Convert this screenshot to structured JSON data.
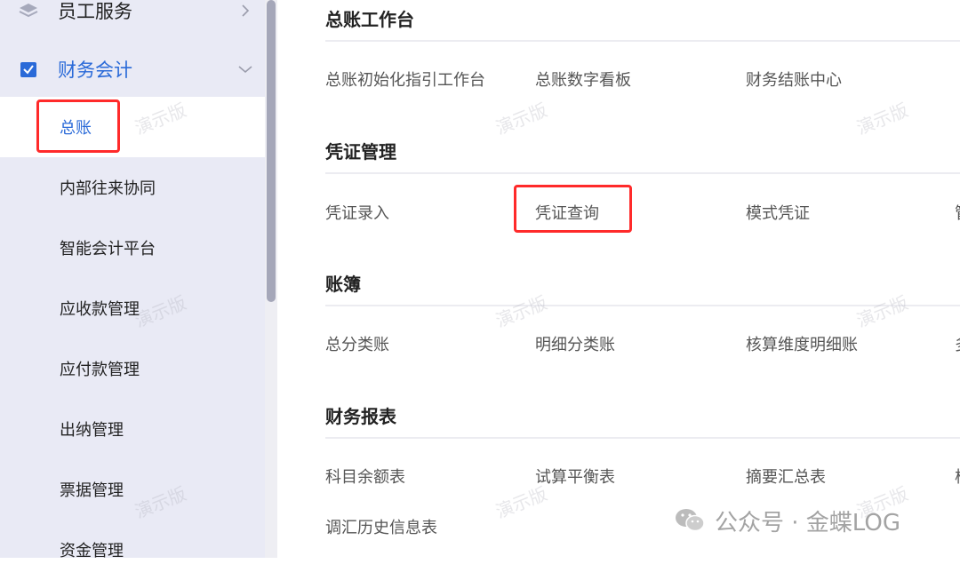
{
  "sidebar": {
    "groups": [
      {
        "label": "员工服务",
        "icon": "layers-icon"
      },
      {
        "label": "财务会计",
        "icon": "checkbox-icon",
        "color": "#2a6ad8"
      }
    ],
    "items": [
      {
        "label": "总账",
        "active": true
      },
      {
        "label": "内部往来协同"
      },
      {
        "label": "智能会计平台"
      },
      {
        "label": "应收款管理"
      },
      {
        "label": "应付款管理"
      },
      {
        "label": "出纳管理"
      },
      {
        "label": "票据管理"
      },
      {
        "label": "资金管理"
      }
    ]
  },
  "main": {
    "sections": [
      {
        "title": "总账工作台",
        "links": [
          "总账初始化指引工作台",
          "总账数字看板",
          "财务结账中心"
        ]
      },
      {
        "title": "凭证管理",
        "links": [
          "凭证录入",
          "凭证查询",
          "模式凭证",
          "管"
        ]
      },
      {
        "title": "账簿",
        "links": [
          "总分类账",
          "明细分类账",
          "核算维度明细账",
          "多"
        ]
      },
      {
        "title": "财务报表",
        "links": [
          "科目余额表",
          "试算平衡表",
          "摘要汇总表",
          "核",
          "调汇历史信息表"
        ]
      }
    ]
  },
  "watermark": "演示版",
  "footer": {
    "text": "公众号 · 金蝶LOG"
  },
  "colors": {
    "accent": "#2a6ad8",
    "highlight": "#ff2a2a",
    "sidebar_bg": "#e9eaf5"
  }
}
